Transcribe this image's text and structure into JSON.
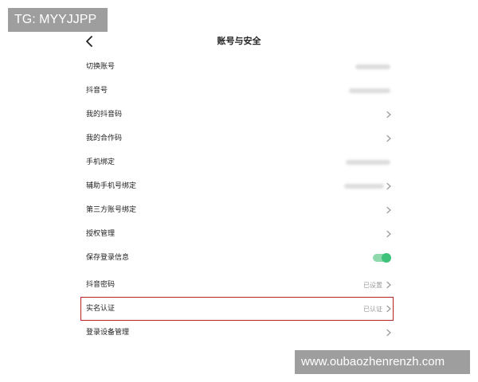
{
  "watermarks": {
    "top_left": "TG: MYYJJPP",
    "bottom_right": "www.oubaozhenrenzh.com"
  },
  "nav": {
    "title": "账号与安全",
    "back_icon": "chevron-left-icon"
  },
  "rows": [
    {
      "label": "切换账号",
      "right": "blurred"
    },
    {
      "label": "抖音号",
      "right": "blurred"
    },
    {
      "label": "我的抖音码",
      "right": "chevron"
    },
    {
      "label": "我的合作码",
      "right": "chevron"
    },
    {
      "label": "手机绑定",
      "right": "blurred"
    },
    {
      "label": "辅助手机号绑定",
      "right": "blurred-chevron"
    },
    {
      "label": "第三方账号绑定",
      "right": "chevron"
    },
    {
      "label": "授权管理",
      "right": "chevron"
    },
    {
      "label": "保存登录信息",
      "right": "toggle"
    },
    {
      "label": "抖音密码",
      "value": "已设置",
      "right": "value-chevron"
    },
    {
      "label": "实名认证",
      "value": "已认证",
      "right": "value-chevron",
      "highlighted": true
    },
    {
      "label": "登录设备管理",
      "right": "chevron"
    }
  ],
  "toggle": {
    "state": "on",
    "track_color": "#8fd9ad",
    "knob_color": "#3ec27a"
  },
  "colors": {
    "highlight_border": "#b22222",
    "secondary_text": "#999999",
    "watermark_bg": "#9e9e9e"
  }
}
